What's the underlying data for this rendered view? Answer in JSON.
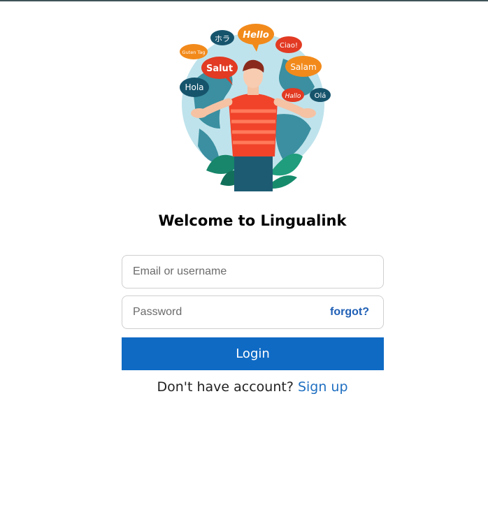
{
  "hero": {
    "greetings": [
      "ホラ",
      "Hello",
      "Ciao!",
      "Guten Tag",
      "Salut",
      "Salam",
      "Hola",
      "Hallo",
      "Olá"
    ]
  },
  "page": {
    "title": "Welcome to Lingualink"
  },
  "form": {
    "email_placeholder": "Email or username",
    "password_placeholder": "Password",
    "forgot_label": "forgot?",
    "login_label": "Login",
    "signup_prompt": "Don't have account?",
    "signup_link": "Sign up"
  }
}
